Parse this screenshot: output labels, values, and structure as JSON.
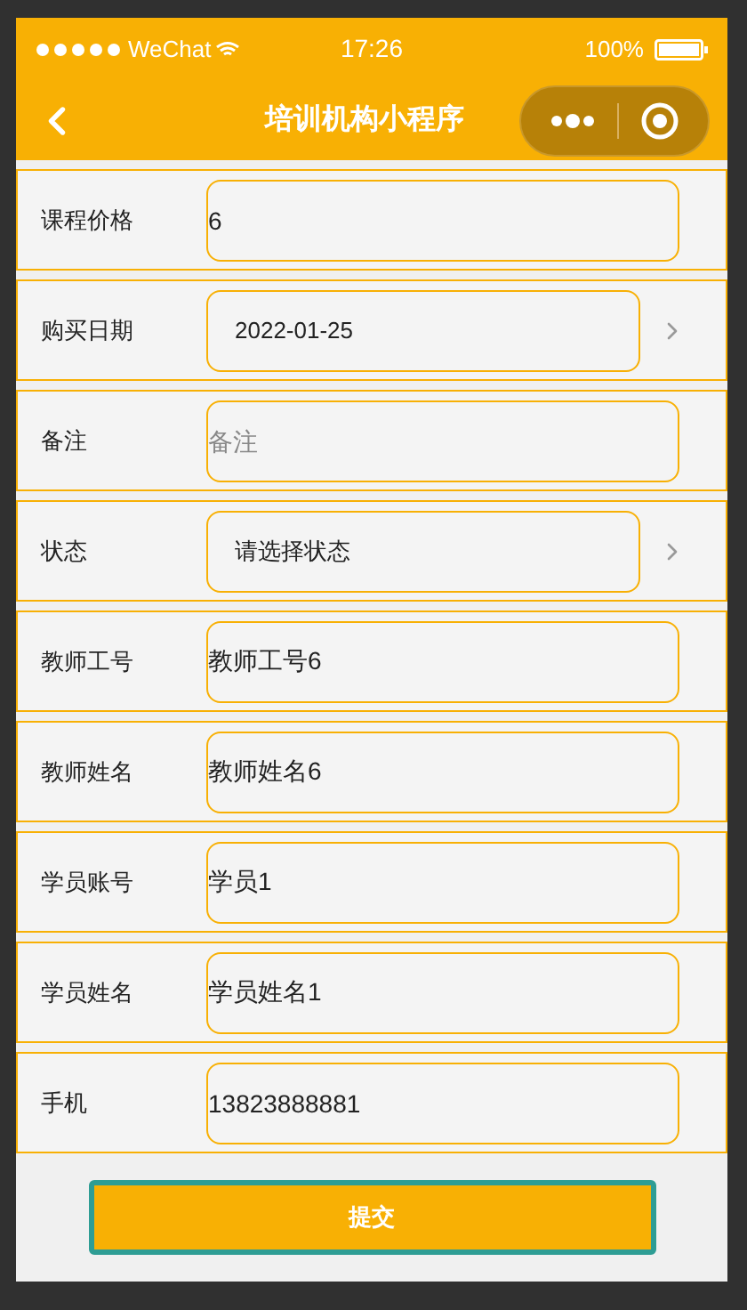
{
  "status_bar": {
    "carrier": "WeChat",
    "time": "17:26",
    "battery": "100%"
  },
  "nav": {
    "title": "培训机构小程序"
  },
  "fields": [
    {
      "kind": "input",
      "label": "课程价格",
      "value": "6"
    },
    {
      "kind": "picker",
      "label": "购买日期",
      "value": "2022-01-25"
    },
    {
      "kind": "input",
      "label": "备注",
      "placeholder": "备注"
    },
    {
      "kind": "picker",
      "label": "状态",
      "value": "请选择状态"
    },
    {
      "kind": "input",
      "label": "教师工号",
      "value": "教师工号6"
    },
    {
      "kind": "input",
      "label": "教师姓名",
      "value": "教师姓名6"
    },
    {
      "kind": "input",
      "label": "学员账号",
      "value": "学员1"
    },
    {
      "kind": "input",
      "label": "学员姓名",
      "value": "学员姓名1"
    },
    {
      "kind": "input",
      "label": "手机",
      "value": "13823888881"
    }
  ],
  "submit": "提交"
}
